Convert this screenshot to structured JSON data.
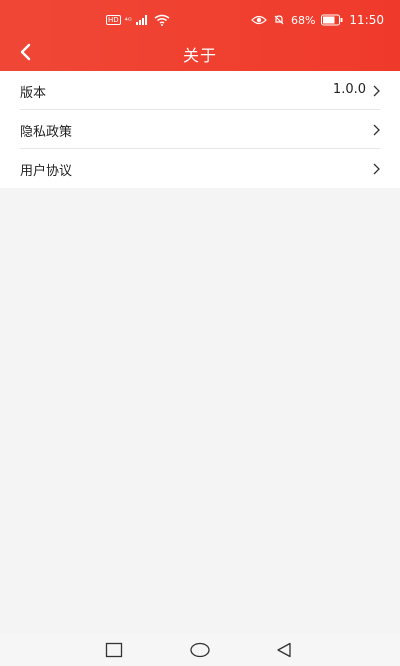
{
  "status_bar": {
    "hd_label": "HD",
    "signal_label": "⁴ᴳ",
    "battery_percent": "68%",
    "time": "11:50"
  },
  "header": {
    "title": "关于"
  },
  "settings": {
    "items": [
      {
        "label": "版本",
        "value": "1.0.0"
      },
      {
        "label": "隐私政策",
        "value": ""
      },
      {
        "label": "用户协议",
        "value": ""
      }
    ]
  },
  "colors": {
    "header_bg": "#f0402f",
    "page_bg": "#f4f4f4",
    "list_bg": "#ffffff"
  }
}
